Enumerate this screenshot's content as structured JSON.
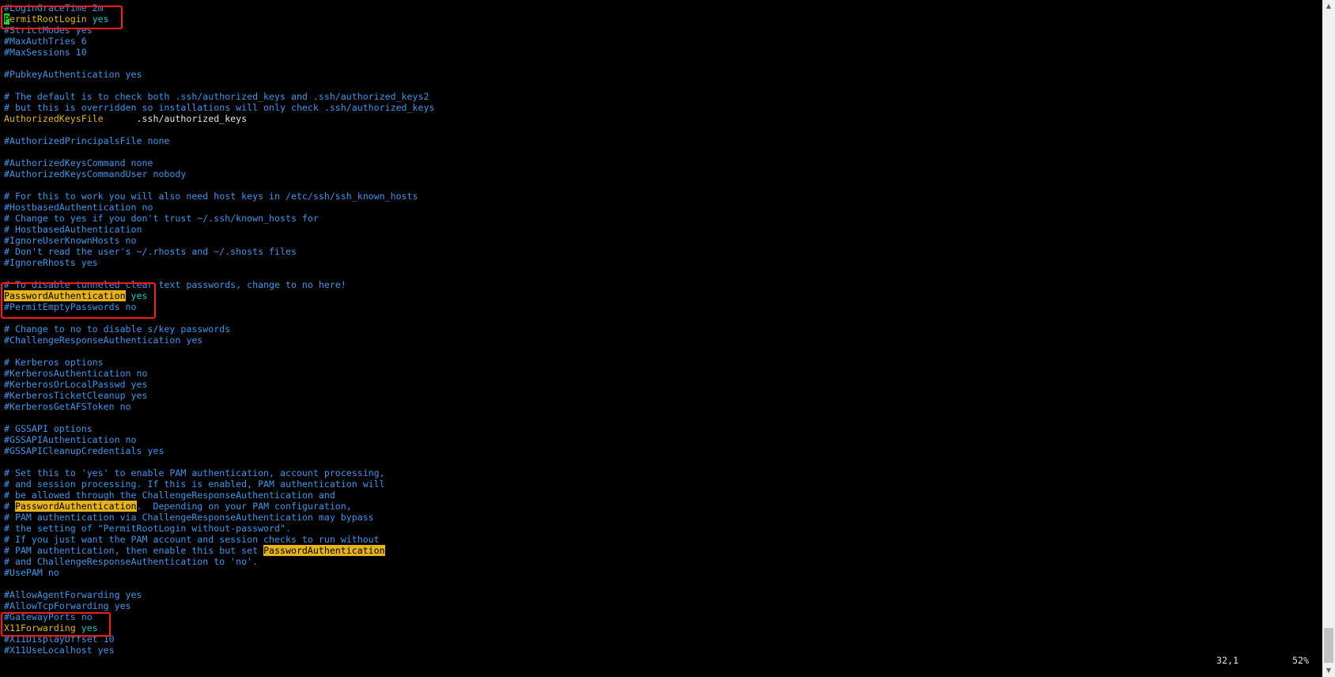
{
  "terminal": {
    "lines": [
      [
        {
          "t": "#LoginGraceTime 2m",
          "c": "comment"
        }
      ],
      [
        {
          "t": "P",
          "c": "cursor"
        },
        {
          "t": "ermitRootLogin",
          "c": "keyword"
        },
        {
          "t": " yes",
          "c": "value"
        }
      ],
      [
        {
          "t": "#StrictModes yes",
          "c": "comment"
        }
      ],
      [
        {
          "t": "#MaxAuthTries 6",
          "c": "comment"
        }
      ],
      [
        {
          "t": "#MaxSessions 10",
          "c": "comment"
        }
      ],
      [],
      [
        {
          "t": "#PubkeyAuthentication yes",
          "c": "comment"
        }
      ],
      [],
      [
        {
          "t": "# The default is to check both .ssh/authorized_keys and .ssh/authorized_keys2",
          "c": "comment"
        }
      ],
      [
        {
          "t": "# but this is overridden so installations will only check .ssh/authorized_keys",
          "c": "comment"
        }
      ],
      [
        {
          "t": "AuthorizedKeysFile",
          "c": "keyword"
        },
        {
          "t": "      .ssh/authorized_keys",
          "c": "plain"
        }
      ],
      [],
      [
        {
          "t": "#AuthorizedPrincipalsFile none",
          "c": "comment"
        }
      ],
      [],
      [
        {
          "t": "#AuthorizedKeysCommand none",
          "c": "comment"
        }
      ],
      [
        {
          "t": "#AuthorizedKeysCommandUser nobody",
          "c": "comment"
        }
      ],
      [],
      [
        {
          "t": "# For this to work you will also need host keys in /etc/ssh/ssh_known_hosts",
          "c": "comment"
        }
      ],
      [
        {
          "t": "#HostbasedAuthentication no",
          "c": "comment"
        }
      ],
      [
        {
          "t": "# Change to yes if you don't trust ~/.ssh/known_hosts for",
          "c": "comment"
        }
      ],
      [
        {
          "t": "# HostbasedAuthentication",
          "c": "comment"
        }
      ],
      [
        {
          "t": "#IgnoreUserKnownHosts no",
          "c": "comment"
        }
      ],
      [
        {
          "t": "# Don't read the user's ~/.rhosts and ~/.shosts files",
          "c": "comment"
        }
      ],
      [
        {
          "t": "#IgnoreRhosts yes",
          "c": "comment"
        }
      ],
      [],
      [
        {
          "t": "# To disable tunneled clear text passwords, change to no here!",
          "c": "comment"
        }
      ],
      [
        {
          "t": "PasswordAuthentication",
          "c": "search"
        },
        {
          "t": " yes",
          "c": "value"
        }
      ],
      [
        {
          "t": "#PermitEmptyPasswords no",
          "c": "comment"
        }
      ],
      [],
      [
        {
          "t": "# Change to no to disable s/key passwords",
          "c": "comment"
        }
      ],
      [
        {
          "t": "#ChallengeResponseAuthentication yes",
          "c": "comment"
        }
      ],
      [],
      [
        {
          "t": "# Kerberos options",
          "c": "comment"
        }
      ],
      [
        {
          "t": "#KerberosAuthentication no",
          "c": "comment"
        }
      ],
      [
        {
          "t": "#KerberosOrLocalPasswd yes",
          "c": "comment"
        }
      ],
      [
        {
          "t": "#KerberosTicketCleanup yes",
          "c": "comment"
        }
      ],
      [
        {
          "t": "#KerberosGetAFSToken no",
          "c": "comment"
        }
      ],
      [],
      [
        {
          "t": "# GSSAPI options",
          "c": "comment"
        }
      ],
      [
        {
          "t": "#GSSAPIAuthentication no",
          "c": "comment"
        }
      ],
      [
        {
          "t": "#GSSAPICleanupCredentials yes",
          "c": "comment"
        }
      ],
      [],
      [
        {
          "t": "# Set this to 'yes' to enable PAM authentication, account processing,",
          "c": "comment"
        }
      ],
      [
        {
          "t": "# and session processing. If this is enabled, PAM authentication will",
          "c": "comment"
        }
      ],
      [
        {
          "t": "# be allowed through the ChallengeResponseAuthentication and",
          "c": "comment"
        }
      ],
      [
        {
          "t": "# ",
          "c": "comment"
        },
        {
          "t": "PasswordAuthentication",
          "c": "search"
        },
        {
          "t": ".  Depending on your PAM configuration,",
          "c": "comment"
        }
      ],
      [
        {
          "t": "# PAM authentication via ChallengeResponseAuthentication may bypass",
          "c": "comment"
        }
      ],
      [
        {
          "t": "# the setting of \"PermitRootLogin without-password\".",
          "c": "comment"
        }
      ],
      [
        {
          "t": "# If you just want the PAM account and session checks to run without",
          "c": "comment"
        }
      ],
      [
        {
          "t": "# PAM authentication, then enable this but set ",
          "c": "comment"
        },
        {
          "t": "PasswordAuthentication",
          "c": "search"
        }
      ],
      [
        {
          "t": "# and ChallengeResponseAuthentication to 'no'.",
          "c": "comment"
        }
      ],
      [
        {
          "t": "#UsePAM no",
          "c": "comment"
        }
      ],
      [],
      [
        {
          "t": "#AllowAgentForwarding yes",
          "c": "comment"
        }
      ],
      [
        {
          "t": "#AllowTcpForwarding yes",
          "c": "comment"
        }
      ],
      [
        {
          "t": "#GatewayPorts no",
          "c": "comment"
        }
      ],
      [
        {
          "t": "X11Forwarding",
          "c": "keyword"
        },
        {
          "t": " yes",
          "c": "value"
        }
      ],
      [
        {
          "t": "#X11DisplayOffset 10",
          "c": "comment"
        }
      ],
      [
        {
          "t": "#X11UseLocalhost yes",
          "c": "comment"
        }
      ]
    ]
  },
  "status": {
    "cursor_position": "32,1",
    "scroll_percent": "52%"
  },
  "scrollbar": {
    "up_arrow_icon": "triangle-up-icon",
    "down_arrow_icon": "triangle-down-icon"
  },
  "annotations": {
    "box_color": "#ff1a1a"
  },
  "colors": {
    "background": "#000000",
    "comment": "#3a96ee",
    "keyword": "#e6b319",
    "value": "#14c8c8",
    "plain": "#e4e4e4",
    "search_highlight": "#e6b319",
    "cursor": "#21d62b"
  }
}
